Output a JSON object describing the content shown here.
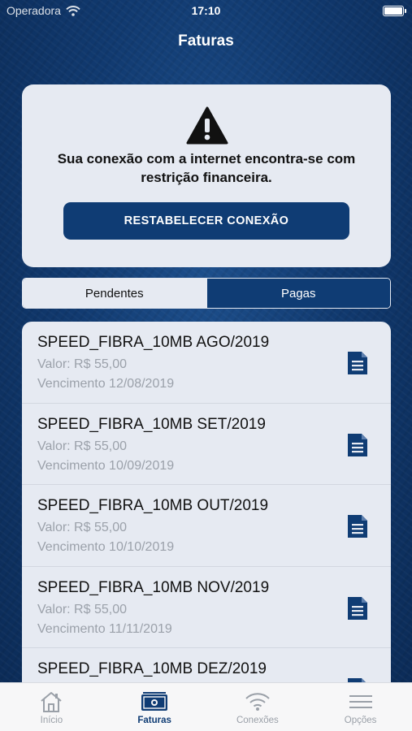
{
  "status_bar": {
    "carrier": "Operadora",
    "time": "17:10"
  },
  "nav": {
    "title": "Faturas"
  },
  "alert": {
    "message": "Sua conexão com a internet encontra-se com restrição financeira.",
    "button_label": "RESTABELECER CONEXÃO",
    "icon": "warning-icon"
  },
  "segments": {
    "pending": "Pendentes",
    "paid": "Pagas",
    "selected": "Pendentes"
  },
  "invoices": [
    {
      "name": "SPEED_FIBRA_10MB AGO/2019",
      "value": "Valor: R$ 55,00",
      "due": "Vencimento 12/08/2019"
    },
    {
      "name": "SPEED_FIBRA_10MB SET/2019",
      "value": "Valor: R$ 55,00",
      "due": "Vencimento 10/09/2019"
    },
    {
      "name": "SPEED_FIBRA_10MB OUT/2019",
      "value": "Valor: R$ 55,00",
      "due": "Vencimento 10/10/2019"
    },
    {
      "name": "SPEED_FIBRA_10MB NOV/2019",
      "value": "Valor: R$ 55,00",
      "due": "Vencimento 11/11/2019"
    },
    {
      "name": "SPEED_FIBRA_10MB DEZ/2019",
      "value": "",
      "due": ""
    }
  ],
  "tabs": [
    {
      "label": "Início",
      "icon": "home-icon",
      "active": false
    },
    {
      "label": "Faturas",
      "icon": "invoice-icon",
      "active": true
    },
    {
      "label": "Conexões",
      "icon": "wifi-icon",
      "active": false
    },
    {
      "label": "Opções",
      "icon": "menu-icon",
      "active": false
    }
  ],
  "colors": {
    "primary": "#0f3c74",
    "card": "#e6eaf2",
    "muted_text": "#9ba1aa",
    "tab_inactive": "#9aa0a8"
  }
}
